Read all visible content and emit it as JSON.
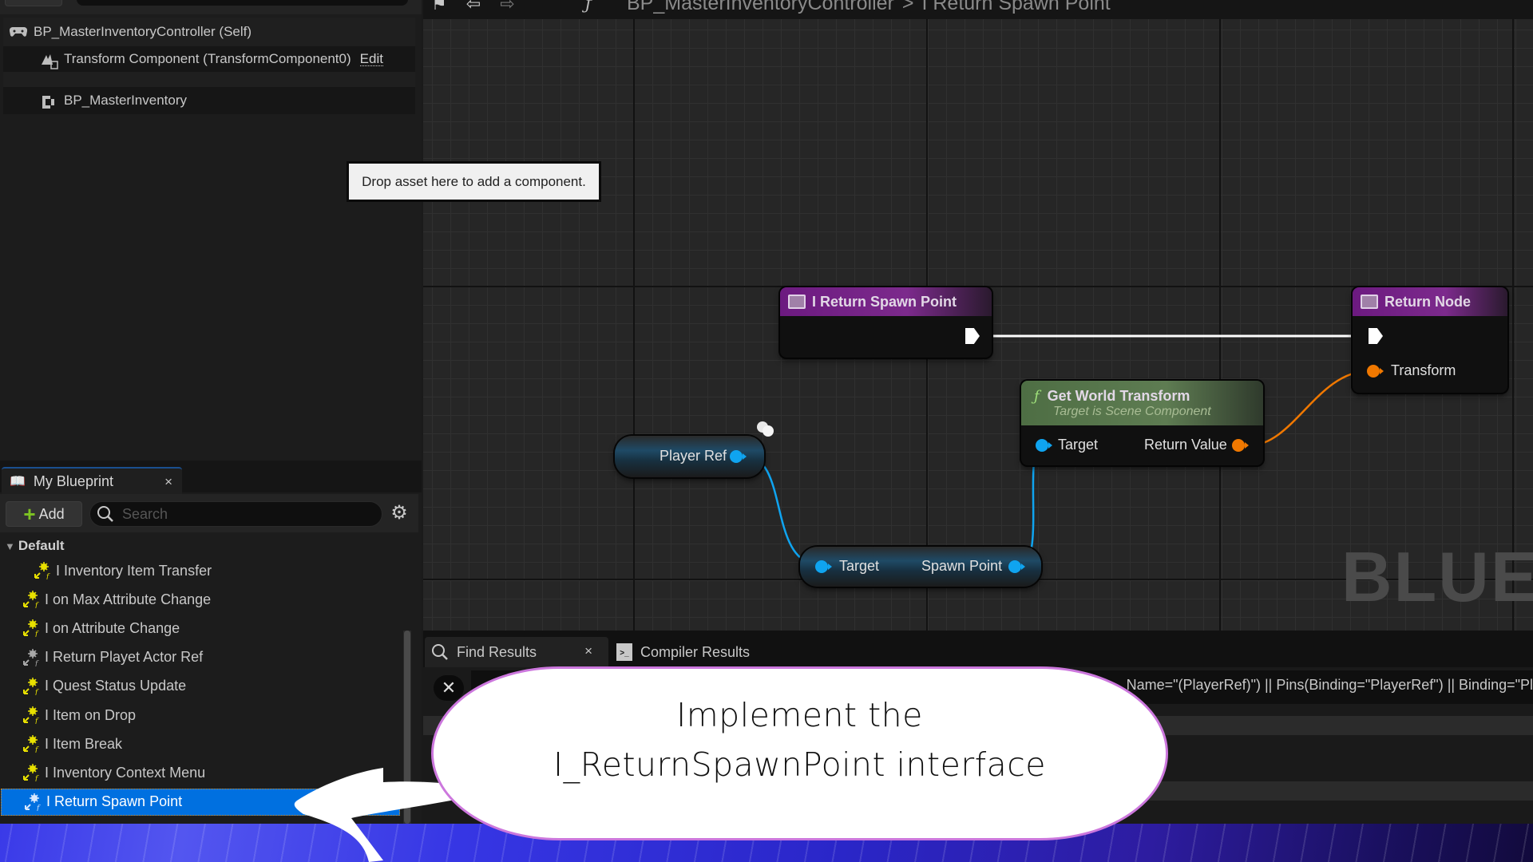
{
  "components": {
    "self_label": "BP_MasterInventoryController (Self)",
    "transform_label": "Transform Component (TransformComponent0)",
    "transform_edit": "Edit",
    "child_label": "BP_MasterInventory",
    "drop_tooltip": "Drop asset here to add a component."
  },
  "my_blueprint": {
    "tab_label": "My Blueprint",
    "tab_close": "×",
    "add_label": "Add",
    "search_placeholder": "Search",
    "category": "Default",
    "items": [
      {
        "label": "I Inventory Item Transfer",
        "icon": "interface-function-icon",
        "implemented": true
      },
      {
        "label": "I on Max Attribute Change",
        "icon": "interface-function-icon",
        "implemented": true
      },
      {
        "label": "I on Attribute Change",
        "icon": "interface-function-icon",
        "implemented": true
      },
      {
        "label": "I Return Playet Actor Ref",
        "icon": "interface-function-icon",
        "implemented": false
      },
      {
        "label": "I Quest Status Update",
        "icon": "interface-function-icon",
        "implemented": true
      },
      {
        "label": "I Item on Drop",
        "icon": "interface-function-icon",
        "implemented": true
      },
      {
        "label": "I Item Break",
        "icon": "interface-function-icon",
        "implemented": true
      },
      {
        "label": "I Inventory Context Menu",
        "icon": "interface-function-icon",
        "implemented": true
      },
      {
        "label": "I Return Spawn Point",
        "icon": "interface-function-icon",
        "implemented": false,
        "selected": true
      }
    ]
  },
  "graph": {
    "breadcrumb": [
      "BP_MasterInventoryController",
      "I Return Spawn Point"
    ],
    "breadcrumb_sep": ">",
    "watermark": "BLUEP",
    "nodes": {
      "entry": {
        "title": "I Return Spawn Point"
      },
      "return": {
        "title": "Return Node",
        "pin_transform": "Transform"
      },
      "get_world_transform": {
        "title": "Get World Transform",
        "subtitle": "Target is Scene Component",
        "pin_target": "Target",
        "pin_return": "Return Value"
      },
      "player_ref": {
        "label": "Player Ref"
      },
      "spawn_point": {
        "pin_target": "Target",
        "pin_out": "Spawn Point"
      }
    },
    "colors": {
      "object_pin": "#0fa4f0",
      "transform_pin": "#f07800",
      "exec_wire": "#ffffff",
      "function_header": "#5e7c52",
      "event_header": "#7c2a8c"
    }
  },
  "bottom_panel": {
    "tabs": [
      {
        "label": "Find Results",
        "active": true,
        "close": "×"
      },
      {
        "label": "Compiler Results",
        "active": false
      }
    ],
    "find_query": "Name=\"(PlayerRef)\") || Pins(Binding=\"PlayerRef\") || Binding=\"Pl"
  },
  "callout": {
    "line1": "Implement the",
    "line2": "I_ReturnSpawnPoint interface"
  }
}
